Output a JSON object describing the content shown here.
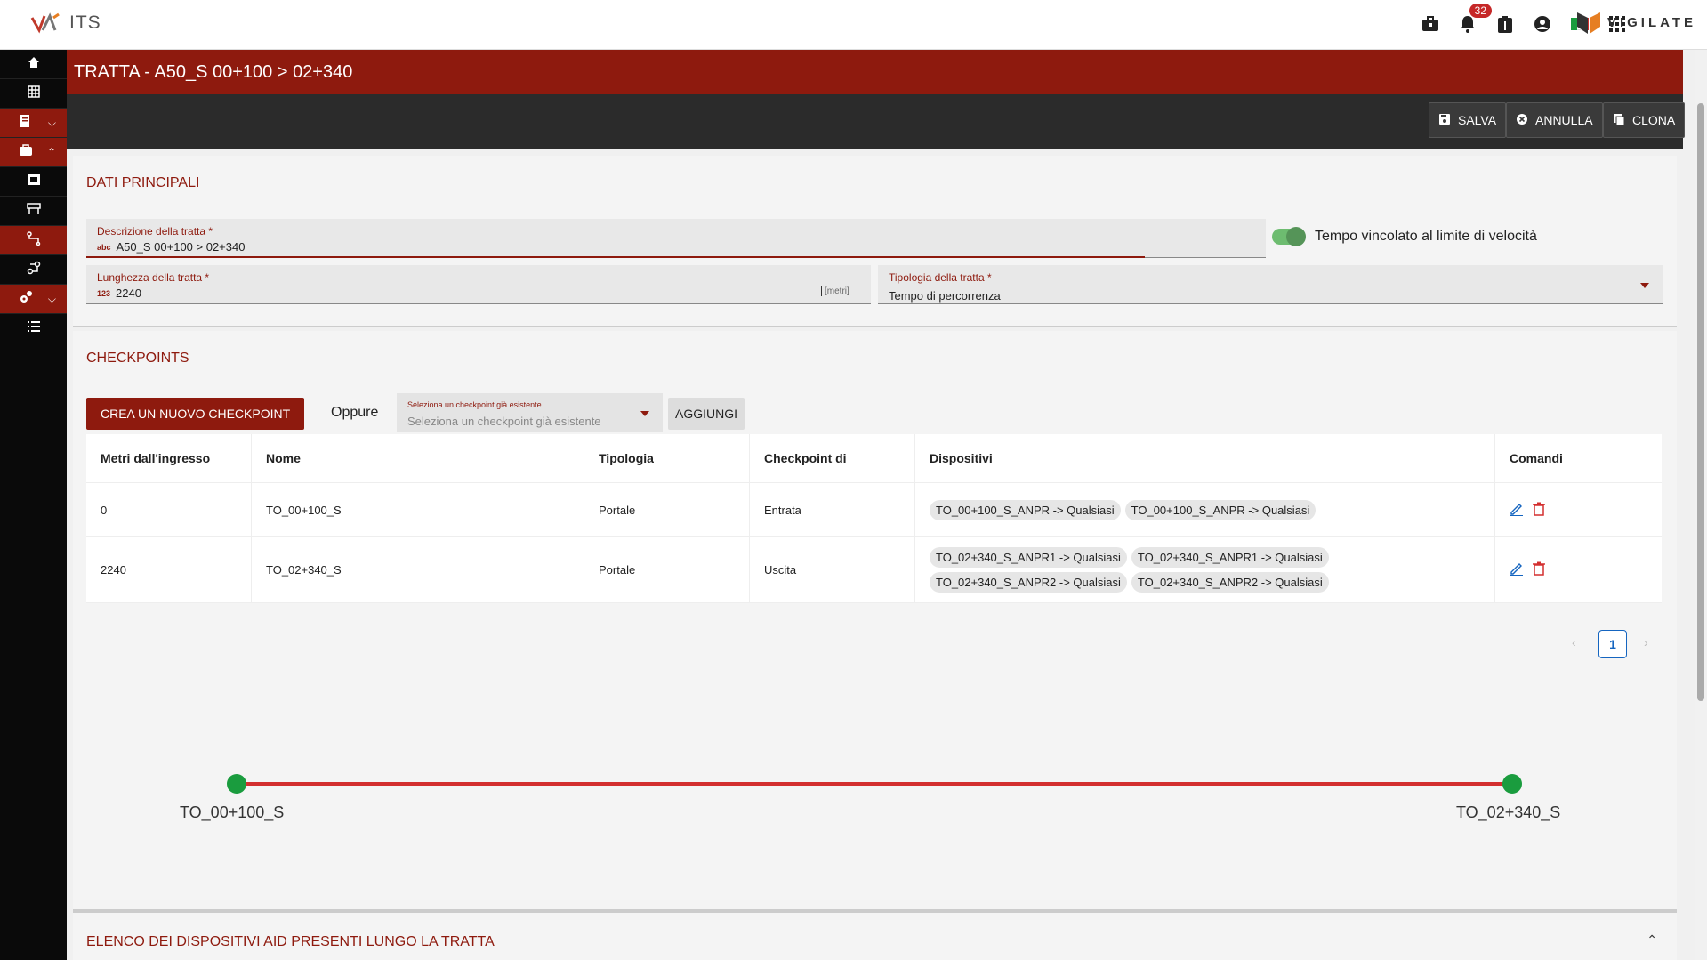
{
  "app": {
    "name": "ITS",
    "brand": "VIGILATE",
    "notifications": "32"
  },
  "header": {
    "title": "TRATTA - A50_S 00+100 > 02+340"
  },
  "actions": {
    "save": "SALVA",
    "cancel": "ANNULLA",
    "clone": "CLONA"
  },
  "main_data": {
    "section_title": "DATI PRINCIPALI",
    "description_label": "Descrizione della tratta *",
    "description_value": "A50_S 00+100 > 02+340",
    "description_prefix": "abc",
    "length_label": "Lunghezza della tratta *",
    "length_value": "2240",
    "length_prefix": "123",
    "length_unit": "[metri]",
    "type_label": "Tipologia della tratta *",
    "type_value": "Tempo di percorrenza",
    "toggle_label": "Tempo vincolato al limite di velocità",
    "toggle_on": true
  },
  "checkpoints": {
    "section_title": "CHECKPOINTS",
    "create_button": "CREA UN NUOVO CHECKPOINT",
    "or_text": "Oppure",
    "select_label": "Seleziona un checkpoint già esistente",
    "select_placeholder": "Seleziona un checkpoint già esistente",
    "add_button": "AGGIUNGI",
    "columns": [
      "Metri dall'ingresso",
      "Nome",
      "Tipologia",
      "Checkpoint di",
      "Dispositivi",
      "Comandi"
    ],
    "rows": [
      {
        "meters": "0",
        "name": "TO_00+100_S",
        "type": "Portale",
        "checkpoint_of": "Entrata",
        "devices": [
          "TO_00+100_S_ANPR -> Qualsiasi",
          "TO_00+100_S_ANPR -> Qualsiasi"
        ]
      },
      {
        "meters": "2240",
        "name": "TO_02+340_S",
        "type": "Portale",
        "checkpoint_of": "Uscita",
        "devices": [
          "TO_02+340_S_ANPR1 -> Qualsiasi",
          "TO_02+340_S_ANPR1 -> Qualsiasi",
          "TO_02+340_S_ANPR2 -> Qualsiasi",
          "TO_02+340_S_ANPR2 -> Qualsiasi"
        ]
      }
    ],
    "page": "1"
  },
  "timeline": {
    "start_label": "TO_00+100_S",
    "end_label": "TO_02+340_S"
  },
  "aid_section": {
    "title": "ELENCO DEI DISPOSITIVI AID PRESENTI LUNGO LA TRATTA"
  },
  "colors": {
    "primary": "#8e1a0e",
    "dark": "#2b2b2b",
    "green": "#1a9c3e",
    "line": "#d32f2f"
  }
}
